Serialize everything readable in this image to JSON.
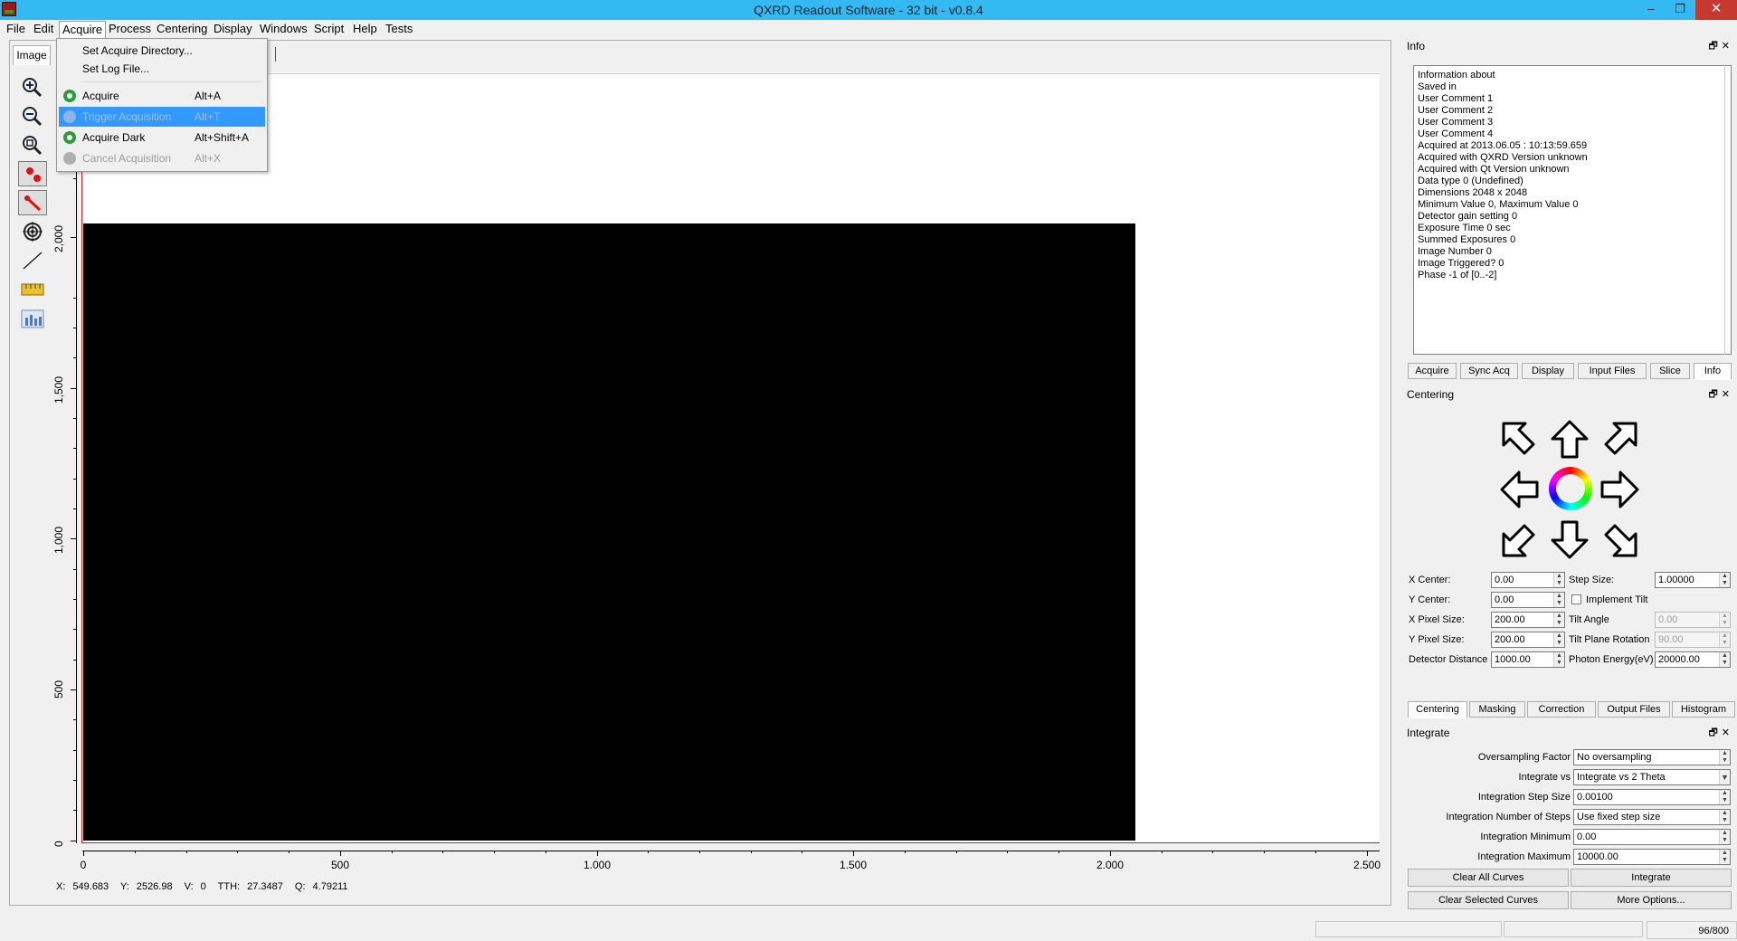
{
  "window": {
    "title": "QXRD Readout Software - 32 bit - v0.8.4"
  },
  "menubar": {
    "items": [
      "File",
      "Edit",
      "Acquire",
      "Process",
      "Centering",
      "Display",
      "Windows",
      "Script",
      "Help",
      "Tests"
    ]
  },
  "acquire_menu": {
    "set_acquire_directory": "Set Acquire Directory...",
    "set_log_file": "Set Log File...",
    "acquire": {
      "label": "Acquire",
      "shortcut": "Alt+A"
    },
    "trigger": {
      "label": "Trigger Acquisition",
      "shortcut": "Alt+T"
    },
    "acquire_dark": {
      "label": "Acquire Dark",
      "shortcut": "Alt+Shift+A"
    },
    "cancel": {
      "label": "Cancel Acquisition",
      "shortcut": "Alt+X"
    }
  },
  "image_tab": {
    "label": "Image"
  },
  "toolbar": {
    "tools": [
      "zoom-in-icon",
      "zoom-out-icon",
      "zoom-fit-icon",
      "set-center-icon",
      "set-ring-icon",
      "centering-target-icon",
      "line-slice-icon",
      "measure-icon",
      "histogram-icon"
    ]
  },
  "plot": {
    "y_ticks": [
      "2,000",
      "1,500",
      "1,000",
      "500",
      "0"
    ],
    "x_ticks": [
      "0",
      "500",
      "1.000",
      "1.500",
      "2.000",
      "2.500"
    ]
  },
  "status": {
    "x_label": "X:",
    "x_value": "549.683",
    "y_label": "Y:",
    "y_value": "2526.98",
    "v_label": "V:",
    "v_value": "0",
    "tth_label": "TTH:",
    "tth_value": "27.3487",
    "q_label": "Q:",
    "q_value": "4.79211"
  },
  "info_dock": {
    "title": "Info",
    "lines": [
      "Information about",
      "Saved in",
      "User Comment 1",
      "User Comment 2",
      "User Comment 3",
      "User Comment 4",
      "Acquired at 2013.06.05 : 10:13:59.659",
      "Acquired with QXRD Version unknown",
      "Acquired with Qt Version unknown",
      "Data type 0 (Undefined)",
      "Dimensions 2048 x 2048",
      "Minimum Value 0, Maximum Value 0",
      "Detector gain setting 0",
      "Exposure Time 0 sec",
      "Summed Exposures 0",
      "Image Number 0",
      "Image Triggered? 0",
      "Phase -1 of [0..-2]"
    ],
    "tabs": [
      "Acquire",
      "Sync Acq",
      "Display",
      "Input Files",
      "Slice",
      "Info"
    ]
  },
  "centering_dock": {
    "title": "Centering",
    "fields": {
      "x_center": {
        "label": "X Center:",
        "value": "0.00"
      },
      "y_center": {
        "label": "Y Center:",
        "value": "0.00"
      },
      "x_pixel": {
        "label": "X Pixel Size:",
        "value": "200.00"
      },
      "y_pixel": {
        "label": "Y Pixel Size:",
        "value": "200.00"
      },
      "det_dist": {
        "label": "Detector Distance",
        "value": "1000.00"
      },
      "step": {
        "label": "Step Size:",
        "value": "1.00000"
      },
      "implement_tilt": {
        "label": "Implement Tilt"
      },
      "tilt_angle": {
        "label": "Tilt Angle",
        "value": "0.00"
      },
      "tilt_rot": {
        "label": "Tilt Plane Rotation",
        "value": "90.00"
      },
      "photon": {
        "label": "Photon Energy(eV)",
        "value": "20000.00"
      }
    },
    "tabs": [
      "Centering",
      "Masking",
      "Correction",
      "Output Files",
      "Histogram"
    ]
  },
  "integrate_dock": {
    "title": "Integrate",
    "fields": {
      "oversampling": {
        "label": "Oversampling Factor",
        "value": "No oversampling"
      },
      "integrate_vs": {
        "label": "Integrate vs",
        "value": "Integrate vs 2 Theta"
      },
      "step_size": {
        "label": "Integration Step Size",
        "value": "0.00100"
      },
      "num_steps": {
        "label": "Integration Number of Steps",
        "value": "Use fixed step size"
      },
      "min": {
        "label": "Integration Minimum",
        "value": "0.00"
      },
      "max": {
        "label": "Integration Maximum",
        "value": "10000.00"
      }
    },
    "buttons": {
      "clear_all": "Clear All Curves",
      "integrate": "Integrate",
      "clear_selected": "Clear Selected Curves",
      "more_options": "More Options..."
    }
  },
  "statusbar": {
    "counter": "96/800"
  }
}
